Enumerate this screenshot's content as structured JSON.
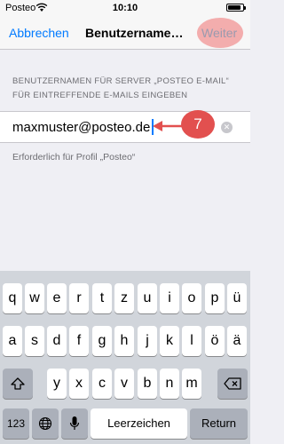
{
  "status": {
    "carrier": "Posteo",
    "time": "10:10"
  },
  "nav": {
    "cancel": "Abbrechen",
    "title": "Benutzername…",
    "next": "Weiter"
  },
  "section": {
    "header": "BENUTZERNAMEN FÜR SERVER „POSTEO E-MAIL“ FÜR EINTREFFENDE E-MAILS EINGEBEN"
  },
  "input": {
    "value": "maxmuster@posteo.de"
  },
  "annotation": {
    "number": "7"
  },
  "footer": {
    "text": "Erforderlich für Profil „Posteo“"
  },
  "keyboard": {
    "row1": [
      "q",
      "w",
      "e",
      "r",
      "t",
      "z",
      "u",
      "i",
      "o",
      "p",
      "ü"
    ],
    "row2": [
      "a",
      "s",
      "d",
      "f",
      "g",
      "h",
      "j",
      "k",
      "l",
      "ö",
      "ä"
    ],
    "row3": [
      "y",
      "x",
      "c",
      "v",
      "b",
      "n",
      "m"
    ],
    "numbers": "123",
    "space": "Leerzeichen",
    "return": "Return"
  },
  "colors": {
    "accent": "#007aff",
    "annotation": "#e2504f"
  }
}
